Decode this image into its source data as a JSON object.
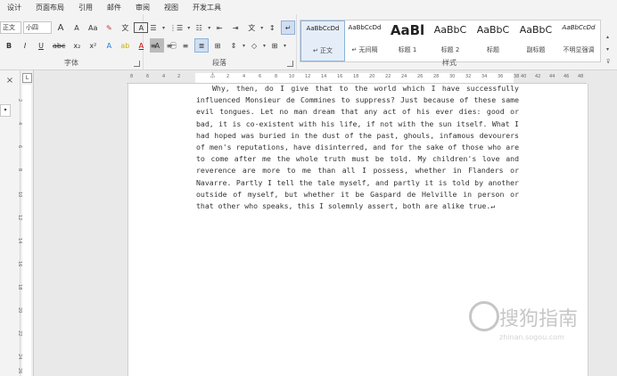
{
  "menubar": {
    "items": [
      "设计",
      "页面布局",
      "引用",
      "邮件",
      "审阅",
      "视图",
      "开发工具"
    ]
  },
  "font": {
    "name": "正文",
    "size": "小四",
    "group_label": "字体",
    "grow_icon": "A",
    "shrink_icon": "A",
    "case_button": "Aa",
    "bold": "B",
    "italic": "I",
    "strike": "abc",
    "sub": "x₂",
    "sup": "x²"
  },
  "paragraph": {
    "group_label": "段落"
  },
  "styles": {
    "group_label": "样式",
    "items": [
      {
        "sample": "AaBbCcDd",
        "name": "↵ 正文",
        "active": true
      },
      {
        "sample": "AaBbCcDd",
        "name": "↵ 无间隔"
      },
      {
        "sample": "AaBl",
        "name": "标题 1"
      },
      {
        "sample": "AaBbC",
        "name": "标题 2"
      },
      {
        "sample": "AaBbC",
        "name": "标题"
      },
      {
        "sample": "AaBbC",
        "name": "副标题"
      },
      {
        "sample": "AaBbCcDd",
        "name": "不明显强调"
      }
    ]
  },
  "ruler": {
    "horizontal": [
      "8",
      "6",
      "4",
      "2",
      "2",
      "4",
      "6",
      "8",
      "10",
      "12",
      "14",
      "16",
      "18",
      "20",
      "22",
      "24",
      "26",
      "28",
      "30",
      "32",
      "34",
      "36",
      "38",
      "40",
      "42",
      "44",
      "46",
      "48"
    ],
    "vertical": [
      "2",
      "4",
      "6",
      "8",
      "10",
      "12",
      "14",
      "16",
      "18",
      "20",
      "22",
      "24",
      "26"
    ]
  },
  "document": {
    "paragraph": "Why, then, do I give that to the world which I have successfully influenced Monsieur de Commines to suppress? Just because of these same evil tongues. Let no man dream that any act of his ever dies: good or bad, it is co-existent with his life, if not with the sun itself. What I had hoped was buried in the dust of the past, ghouls, infamous devourers of men's reputations, have disinterred, and for the sake of those who are to come after me the whole truth must be told. My children's love and reverence are more to me than all I possess, whether in Flanders or Navarre. Partly I tell the tale myself, and partly it is told by another outside of myself, but whether it be Gaspard de Helville in person or that other who speaks, this I solemnly assert, both are alike true.↵"
  },
  "watermark": {
    "text": "搜狗指南",
    "url": "zhinan.sogou.com"
  },
  "colors": {
    "ribbon_bg": "#f3f3f3",
    "workspace_bg": "#e9e9e9",
    "page_bg": "#ffffff",
    "accent": "#2b579a"
  },
  "pane": {
    "close_label": "×"
  }
}
